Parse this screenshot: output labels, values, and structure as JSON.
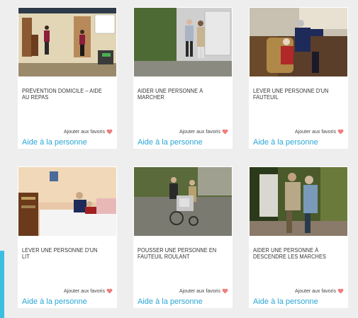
{
  "cards": [
    {
      "title": "PRÉVENTION DOMICILE – AIDE AU REPAS",
      "favorite_label": "Ajouter aux favoris",
      "category": "Aide à la personne",
      "thumb_icon": "video-thumbnail-icon"
    },
    {
      "title": "AIDER UNE PERSONNE À MARCHER",
      "favorite_label": "Ajouter aux favoris",
      "category": "Aide à la personne",
      "thumb_icon": "video-thumbnail-icon"
    },
    {
      "title": "LEVER UNE PERSONNE D'UN FAUTEUIL",
      "favorite_label": "Ajouter aux favoris",
      "category": "Aide à la personne",
      "thumb_icon": "video-thumbnail-icon"
    },
    {
      "title": "LEVER UNE PERSONNE D'UN LIT",
      "favorite_label": "Ajouter aux favoris",
      "category": "Aide à la personne",
      "thumb_icon": "video-thumbnail-icon"
    },
    {
      "title": "POUSSER UNE PERSONNE EN FAUTEUIL ROULANT",
      "favorite_label": "Ajouter aux favoris",
      "category": "Aide à la personne",
      "thumb_icon": "video-thumbnail-icon"
    },
    {
      "title": "AIDER UNE PERSONNE À DESCENDRE LES MARCHES",
      "favorite_label": "Ajouter aux favoris",
      "category": "Aide à la personne",
      "thumb_icon": "video-thumbnail-icon"
    }
  ],
  "colors": {
    "background": "#eeeeee",
    "card": "#ffffff",
    "category_link": "#2aa6d6",
    "heart": "#f07c7c",
    "accent_bar": "#3bbfe0"
  }
}
